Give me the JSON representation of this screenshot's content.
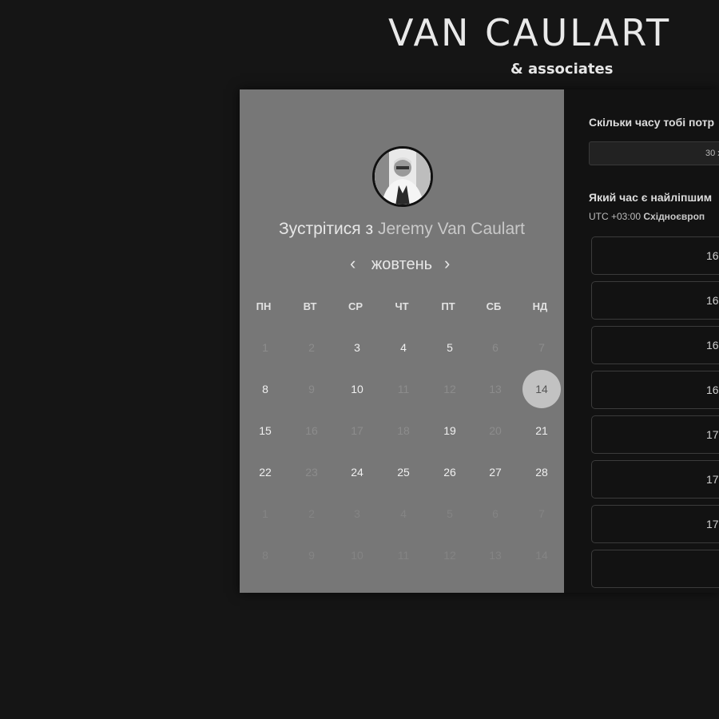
{
  "brand": {
    "name": "VAN CAULART",
    "sub": "& associates"
  },
  "colors": {
    "page_bg": "#151515",
    "calendar_bg": "#777777",
    "panel_bg": "#121212",
    "selected_day_bg": "#c2c2c2"
  },
  "host": {
    "prefix": "Зустрітися з",
    "name": "Jeremy Van Caulart",
    "avatar_icon": "person-photo-icon"
  },
  "calendar": {
    "month": "жовтень",
    "prev_icon": "chevron-left-icon",
    "next_icon": "chevron-right-icon",
    "weekdays": [
      "ПН",
      "ВТ",
      "СР",
      "ЧТ",
      "ПТ",
      "СБ",
      "НД"
    ],
    "weeks": [
      [
        {
          "d": "1",
          "s": "unavailable"
        },
        {
          "d": "2",
          "s": "unavailable"
        },
        {
          "d": "3",
          "s": "available"
        },
        {
          "d": "4",
          "s": "available"
        },
        {
          "d": "5",
          "s": "available"
        },
        {
          "d": "6",
          "s": "unavailable"
        },
        {
          "d": "7",
          "s": "unavailable"
        }
      ],
      [
        {
          "d": "8",
          "s": "available"
        },
        {
          "d": "9",
          "s": "unavailable"
        },
        {
          "d": "10",
          "s": "available"
        },
        {
          "d": "11",
          "s": "unavailable"
        },
        {
          "d": "12",
          "s": "unavailable"
        },
        {
          "d": "13",
          "s": "unavailable"
        },
        {
          "d": "14",
          "s": "selected"
        }
      ],
      [
        {
          "d": "15",
          "s": "available"
        },
        {
          "d": "16",
          "s": "unavailable"
        },
        {
          "d": "17",
          "s": "unavailable"
        },
        {
          "d": "18",
          "s": "unavailable"
        },
        {
          "d": "19",
          "s": "available"
        },
        {
          "d": "20",
          "s": "unavailable"
        },
        {
          "d": "21",
          "s": "available"
        }
      ],
      [
        {
          "d": "22",
          "s": "available"
        },
        {
          "d": "23",
          "s": "unavailable"
        },
        {
          "d": "24",
          "s": "available"
        },
        {
          "d": "25",
          "s": "available"
        },
        {
          "d": "26",
          "s": "available"
        },
        {
          "d": "27",
          "s": "available"
        },
        {
          "d": "28",
          "s": "available"
        }
      ],
      [
        {
          "d": "1",
          "s": "other"
        },
        {
          "d": "2",
          "s": "other"
        },
        {
          "d": "3",
          "s": "other"
        },
        {
          "d": "4",
          "s": "other"
        },
        {
          "d": "5",
          "s": "other"
        },
        {
          "d": "6",
          "s": "other"
        },
        {
          "d": "7",
          "s": "other"
        }
      ],
      [
        {
          "d": "8",
          "s": "other"
        },
        {
          "d": "9",
          "s": "other"
        },
        {
          "d": "10",
          "s": "other"
        },
        {
          "d": "11",
          "s": "other"
        },
        {
          "d": "12",
          "s": "other"
        },
        {
          "d": "13",
          "s": "other"
        },
        {
          "d": "14",
          "s": "other"
        }
      ]
    ]
  },
  "booking": {
    "duration_question": "Скільки часу тобі потр",
    "duration_value": "30 х",
    "time_question": "Який час є найліпшим",
    "timezone_offset": "UTC +03:00",
    "timezone_name": "Східноєвроп",
    "slots": [
      "16",
      "16",
      "16",
      "16",
      "17",
      "17",
      "17",
      ""
    ]
  }
}
